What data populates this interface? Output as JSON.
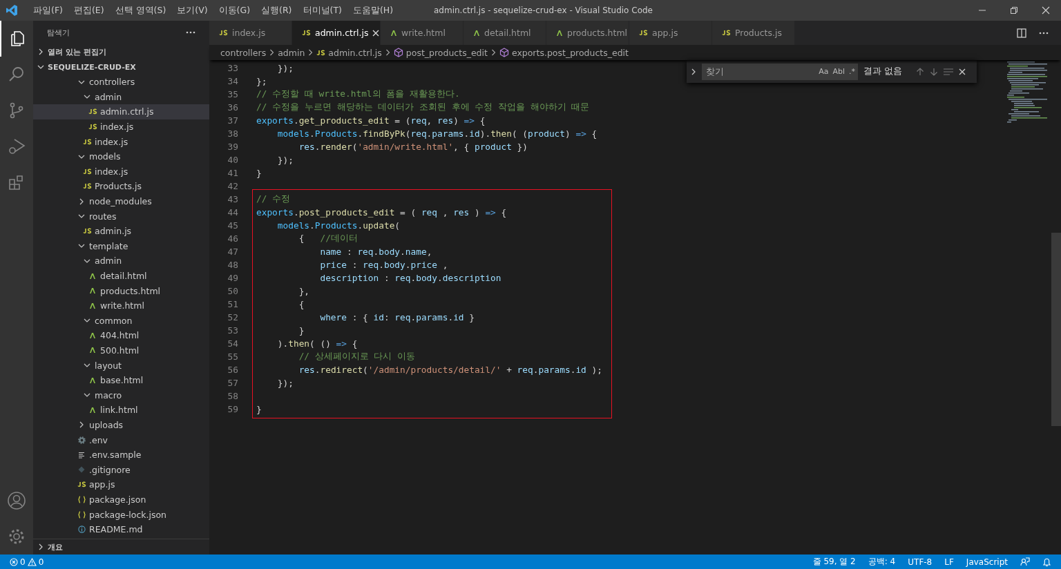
{
  "window": {
    "title": "admin.ctrl.js - sequelize-crud-ex - Visual Studio Code"
  },
  "menu": [
    "파일(F)",
    "편집(E)",
    "선택 영역(S)",
    "보기(V)",
    "이동(G)",
    "실행(R)",
    "터미널(T)",
    "도움말(H)"
  ],
  "explorer": {
    "title": "탐색기",
    "open_editors": "열려 있는 편집기",
    "root": "SEQUELIZE-CRUD-EX",
    "outline": "개요",
    "tree": [
      {
        "name": "controllers",
        "kind": "folder",
        "expanded": true,
        "selected": false,
        "children": [
          {
            "name": "admin",
            "kind": "folder",
            "expanded": true,
            "selected": false,
            "children": [
              {
                "name": "admin.ctrl.js",
                "kind": "js",
                "selected": true
              },
              {
                "name": "index.js",
                "kind": "js",
                "selected": false
              }
            ]
          },
          {
            "name": "index.js",
            "kind": "js",
            "selected": false
          }
        ]
      },
      {
        "name": "models",
        "kind": "folder",
        "expanded": true,
        "selected": false,
        "children": [
          {
            "name": "index.js",
            "kind": "js",
            "selected": false
          },
          {
            "name": "Products.js",
            "kind": "js",
            "selected": false
          }
        ]
      },
      {
        "name": "node_modules",
        "kind": "folder",
        "expanded": false,
        "selected": false
      },
      {
        "name": "routes",
        "kind": "folder",
        "expanded": true,
        "selected": false,
        "children": [
          {
            "name": "admin.js",
            "kind": "js",
            "selected": false
          }
        ]
      },
      {
        "name": "template",
        "kind": "folder",
        "expanded": true,
        "selected": false,
        "children": [
          {
            "name": "admin",
            "kind": "folder",
            "expanded": true,
            "selected": false,
            "children": [
              {
                "name": "detail.html",
                "kind": "html",
                "selected": false
              },
              {
                "name": "products.html",
                "kind": "html",
                "selected": false
              },
              {
                "name": "write.html",
                "kind": "html",
                "selected": false
              }
            ]
          },
          {
            "name": "common",
            "kind": "folder",
            "expanded": true,
            "selected": false,
            "children": [
              {
                "name": "404.html",
                "kind": "html",
                "selected": false
              },
              {
                "name": "500.html",
                "kind": "html",
                "selected": false
              }
            ]
          },
          {
            "name": "layout",
            "kind": "folder",
            "expanded": true,
            "selected": false,
            "children": [
              {
                "name": "base.html",
                "kind": "html",
                "selected": false
              }
            ]
          },
          {
            "name": "macro",
            "kind": "folder",
            "expanded": true,
            "selected": false,
            "children": [
              {
                "name": "link.html",
                "kind": "html",
                "selected": false
              }
            ]
          }
        ]
      },
      {
        "name": "uploads",
        "kind": "folder",
        "expanded": false,
        "selected": false
      },
      {
        "name": ".env",
        "kind": "gear",
        "selected": false
      },
      {
        "name": ".env.sample",
        "kind": "lines",
        "selected": false
      },
      {
        "name": ".gitignore",
        "kind": "git",
        "selected": false
      },
      {
        "name": "app.js",
        "kind": "js",
        "selected": false
      },
      {
        "name": "package.json",
        "kind": "json",
        "selected": false
      },
      {
        "name": "package-lock.json",
        "kind": "json",
        "selected": false
      },
      {
        "name": "README.md",
        "kind": "info",
        "selected": false
      }
    ]
  },
  "tabs": [
    {
      "label": "index.js",
      "kind": "js",
      "selected": false
    },
    {
      "label": "admin.ctrl.js",
      "kind": "js",
      "selected": true
    },
    {
      "label": "write.html",
      "kind": "html",
      "selected": false
    },
    {
      "label": "detail.html",
      "kind": "html",
      "selected": false
    },
    {
      "label": "products.html",
      "kind": "html",
      "selected": false
    },
    {
      "label": "app.js",
      "kind": "js",
      "selected": false
    },
    {
      "label": "Products.js",
      "kind": "js",
      "selected": false
    }
  ],
  "breadcrumb": [
    {
      "label": "controllers",
      "kind": "folder"
    },
    {
      "label": "admin",
      "kind": "folder"
    },
    {
      "label": "admin.ctrl.js",
      "kind": "js"
    },
    {
      "label": "post_products_edit",
      "kind": "symbol"
    },
    {
      "label": "exports.post_products_edit",
      "kind": "symbol"
    }
  ],
  "find": {
    "placeholder": "찾기",
    "options": [
      "Aa",
      "Abl",
      ".*"
    ],
    "result": "결과 없음"
  },
  "code": [
    {
      "highlighted": false,
      "lines": [
        {
          "n": "33",
          "tokens": [
            {
              "text": "    });",
              "kind": "plain"
            }
          ]
        },
        {
          "n": "34",
          "tokens": [
            {
              "text": "};",
              "kind": "plain"
            }
          ]
        },
        {
          "n": "35",
          "tokens": [
            {
              "text": "// 수정할 때 write.html의 폼을 재활용한다.",
              "kind": "comment"
            }
          ]
        },
        {
          "n": "36",
          "tokens": [
            {
              "text": "// 수정을 누르면 해당하는 데이터가 조회된 후에 수정 작업을 해야하기 때문",
              "kind": "comment"
            }
          ]
        },
        {
          "n": "37",
          "tokens": [
            {
              "text": "exports",
              "kind": "object"
            },
            {
              "text": ".",
              "kind": "plain"
            },
            {
              "text": "get_products_edit",
              "kind": "function"
            },
            {
              "text": " = (",
              "kind": "plain"
            },
            {
              "text": "req",
              "kind": "variable"
            },
            {
              "text": ", ",
              "kind": "plain"
            },
            {
              "text": "res",
              "kind": "variable"
            },
            {
              "text": ") ",
              "kind": "plain"
            },
            {
              "text": "=>",
              "kind": "keyword"
            },
            {
              "text": " {",
              "kind": "plain"
            }
          ]
        },
        {
          "n": "38",
          "tokens": [
            {
              "text": "    models",
              "kind": "object"
            },
            {
              "text": ".",
              "kind": "plain"
            },
            {
              "text": "Products",
              "kind": "object"
            },
            {
              "text": ".",
              "kind": "plain"
            },
            {
              "text": "findByPk",
              "kind": "function"
            },
            {
              "text": "(",
              "kind": "plain"
            },
            {
              "text": "req",
              "kind": "variable"
            },
            {
              "text": ".",
              "kind": "plain"
            },
            {
              "text": "params",
              "kind": "variable"
            },
            {
              "text": ".",
              "kind": "plain"
            },
            {
              "text": "id",
              "kind": "variable"
            },
            {
              "text": ").",
              "kind": "plain"
            },
            {
              "text": "then",
              "kind": "function"
            },
            {
              "text": "( (",
              "kind": "plain"
            },
            {
              "text": "product",
              "kind": "variable"
            },
            {
              "text": ") ",
              "kind": "plain"
            },
            {
              "text": "=>",
              "kind": "keyword"
            },
            {
              "text": " {",
              "kind": "plain"
            }
          ]
        },
        {
          "n": "39",
          "tokens": [
            {
              "text": "        res",
              "kind": "variable"
            },
            {
              "text": ".",
              "kind": "plain"
            },
            {
              "text": "render",
              "kind": "function"
            },
            {
              "text": "(",
              "kind": "plain"
            },
            {
              "text": "'admin/write.html'",
              "kind": "string"
            },
            {
              "text": ", { ",
              "kind": "plain"
            },
            {
              "text": "product",
              "kind": "variable"
            },
            {
              "text": " })",
              "kind": "plain"
            }
          ]
        },
        {
          "n": "40",
          "tokens": [
            {
              "text": "    });",
              "kind": "plain"
            }
          ]
        },
        {
          "n": "41",
          "tokens": [
            {
              "text": "}",
              "kind": "plain"
            }
          ]
        },
        {
          "n": "42"
        }
      ]
    },
    {
      "highlighted": true,
      "lines": [
        {
          "n": "43",
          "tokens": [
            {
              "text": "// 수정",
              "kind": "comment"
            }
          ]
        },
        {
          "n": "44",
          "tokens": [
            {
              "text": "exports",
              "kind": "object"
            },
            {
              "text": ".",
              "kind": "plain"
            },
            {
              "text": "post_products_edit",
              "kind": "function"
            },
            {
              "text": " = ( ",
              "kind": "plain"
            },
            {
              "text": "req",
              "kind": "variable"
            },
            {
              "text": " , ",
              "kind": "plain"
            },
            {
              "text": "res",
              "kind": "variable"
            },
            {
              "text": " ) ",
              "kind": "plain"
            },
            {
              "text": "=>",
              "kind": "keyword"
            },
            {
              "text": " {",
              "kind": "plain"
            }
          ]
        },
        {
          "n": "45",
          "tokens": [
            {
              "text": "    models",
              "kind": "object"
            },
            {
              "text": ".",
              "kind": "plain"
            },
            {
              "text": "Products",
              "kind": "object"
            },
            {
              "text": ".",
              "kind": "plain"
            },
            {
              "text": "update",
              "kind": "function"
            },
            {
              "text": "(",
              "kind": "plain"
            }
          ]
        },
        {
          "n": "46",
          "tokens": [
            {
              "text": "        {   ",
              "kind": "plain"
            },
            {
              "text": "//데이터",
              "kind": "comment"
            }
          ]
        },
        {
          "n": "47",
          "tokens": [
            {
              "text": "            name",
              "kind": "variable"
            },
            {
              "text": " : ",
              "kind": "plain"
            },
            {
              "text": "req",
              "kind": "variable"
            },
            {
              "text": ".",
              "kind": "plain"
            },
            {
              "text": "body",
              "kind": "variable"
            },
            {
              "text": ".",
              "kind": "plain"
            },
            {
              "text": "name",
              "kind": "variable"
            },
            {
              "text": ",",
              "kind": "plain"
            }
          ]
        },
        {
          "n": "48",
          "tokens": [
            {
              "text": "            price",
              "kind": "variable"
            },
            {
              "text": " : ",
              "kind": "plain"
            },
            {
              "text": "req",
              "kind": "variable"
            },
            {
              "text": ".",
              "kind": "plain"
            },
            {
              "text": "body",
              "kind": "variable"
            },
            {
              "text": ".",
              "kind": "plain"
            },
            {
              "text": "price",
              "kind": "variable"
            },
            {
              "text": " ,",
              "kind": "plain"
            }
          ]
        },
        {
          "n": "49",
          "tokens": [
            {
              "text": "            description",
              "kind": "variable"
            },
            {
              "text": " : ",
              "kind": "plain"
            },
            {
              "text": "req",
              "kind": "variable"
            },
            {
              "text": ".",
              "kind": "plain"
            },
            {
              "text": "body",
              "kind": "variable"
            },
            {
              "text": ".",
              "kind": "plain"
            },
            {
              "text": "description",
              "kind": "variable"
            }
          ]
        },
        {
          "n": "50",
          "tokens": [
            {
              "text": "        },",
              "kind": "plain"
            }
          ]
        },
        {
          "n": "51",
          "tokens": [
            {
              "text": "        {",
              "kind": "plain"
            }
          ]
        },
        {
          "n": "52",
          "tokens": [
            {
              "text": "            where",
              "kind": "variable"
            },
            {
              "text": " : { ",
              "kind": "plain"
            },
            {
              "text": "id",
              "kind": "variable"
            },
            {
              "text": ": ",
              "kind": "plain"
            },
            {
              "text": "req",
              "kind": "variable"
            },
            {
              "text": ".",
              "kind": "plain"
            },
            {
              "text": "params",
              "kind": "variable"
            },
            {
              "text": ".",
              "kind": "plain"
            },
            {
              "text": "id",
              "kind": "variable"
            },
            {
              "text": " }",
              "kind": "plain"
            }
          ]
        },
        {
          "n": "53",
          "tokens": [
            {
              "text": "        }",
              "kind": "plain"
            }
          ]
        },
        {
          "n": "54",
          "tokens": [
            {
              "text": "    ).",
              "kind": "plain"
            },
            {
              "text": "then",
              "kind": "function"
            },
            {
              "text": "( () ",
              "kind": "plain"
            },
            {
              "text": "=>",
              "kind": "keyword"
            },
            {
              "text": " {",
              "kind": "plain"
            }
          ]
        },
        {
          "n": "55",
          "tokens": [
            {
              "text": "        // 상세페이지로 다시 이동",
              "kind": "comment"
            }
          ]
        },
        {
          "n": "56",
          "tokens": [
            {
              "text": "        res",
              "kind": "variable"
            },
            {
              "text": ".",
              "kind": "plain"
            },
            {
              "text": "redirect",
              "kind": "function"
            },
            {
              "text": "(",
              "kind": "plain"
            },
            {
              "text": "'/admin/products/detail/'",
              "kind": "string"
            },
            {
              "text": " + ",
              "kind": "plain"
            },
            {
              "text": "req",
              "kind": "variable"
            },
            {
              "text": ".",
              "kind": "plain"
            },
            {
              "text": "params",
              "kind": "variable"
            },
            {
              "text": ".",
              "kind": "plain"
            },
            {
              "text": "id",
              "kind": "variable"
            },
            {
              "text": " );",
              "kind": "plain"
            }
          ]
        },
        {
          "n": "57",
          "tokens": [
            {
              "text": "    });",
              "kind": "plain"
            }
          ]
        },
        {
          "n": "58"
        },
        {
          "n": "59",
          "tokens": [
            {
              "text": "}",
              "kind": "plain"
            }
          ]
        }
      ]
    }
  ],
  "status_bar": {
    "errors": "0",
    "warnings": "0",
    "items": [
      "줄 59, 열 2",
      "공백: 4",
      "UTF-8",
      "LF",
      "JavaScript"
    ]
  }
}
